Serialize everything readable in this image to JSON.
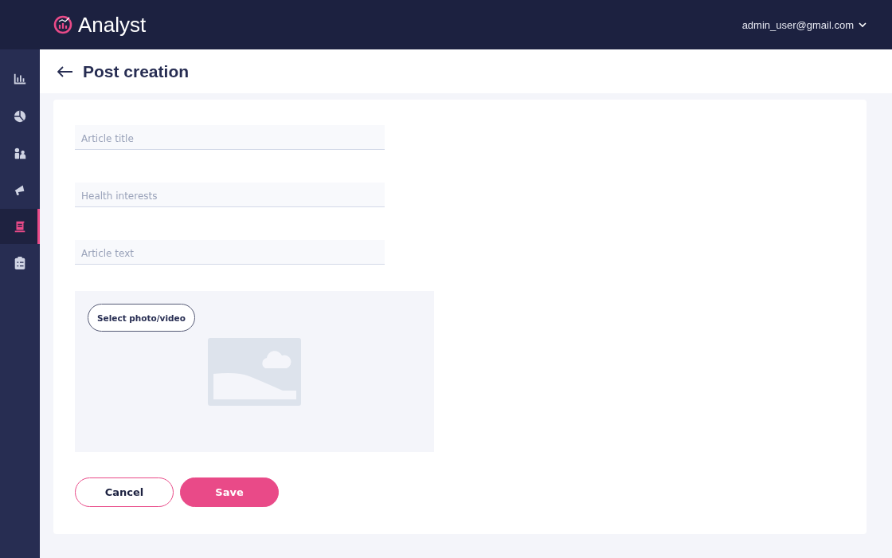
{
  "header": {
    "logo": "Analyst",
    "user": "admin_user@gmail.com"
  },
  "sidebar": {
    "items": [
      {
        "kind": "chart",
        "selected": false
      },
      {
        "kind": "pie",
        "selected": false
      },
      {
        "kind": "people",
        "selected": false
      },
      {
        "kind": "megaphone",
        "selected": false
      },
      {
        "kind": "scroll",
        "selected": true
      },
      {
        "kind": "clipboard",
        "selected": false
      }
    ]
  },
  "page": {
    "title": "Post creation"
  },
  "form": {
    "fields": [
      {
        "placeholder": "Article title"
      },
      {
        "placeholder": "Health interests"
      },
      {
        "placeholder": "Article text"
      }
    ],
    "media": {
      "button": "Select photo/video"
    },
    "buttons": [
      {
        "label": "Cancel",
        "kind": "secondary"
      },
      {
        "label": "Save",
        "kind": "primary"
      }
    ]
  }
}
